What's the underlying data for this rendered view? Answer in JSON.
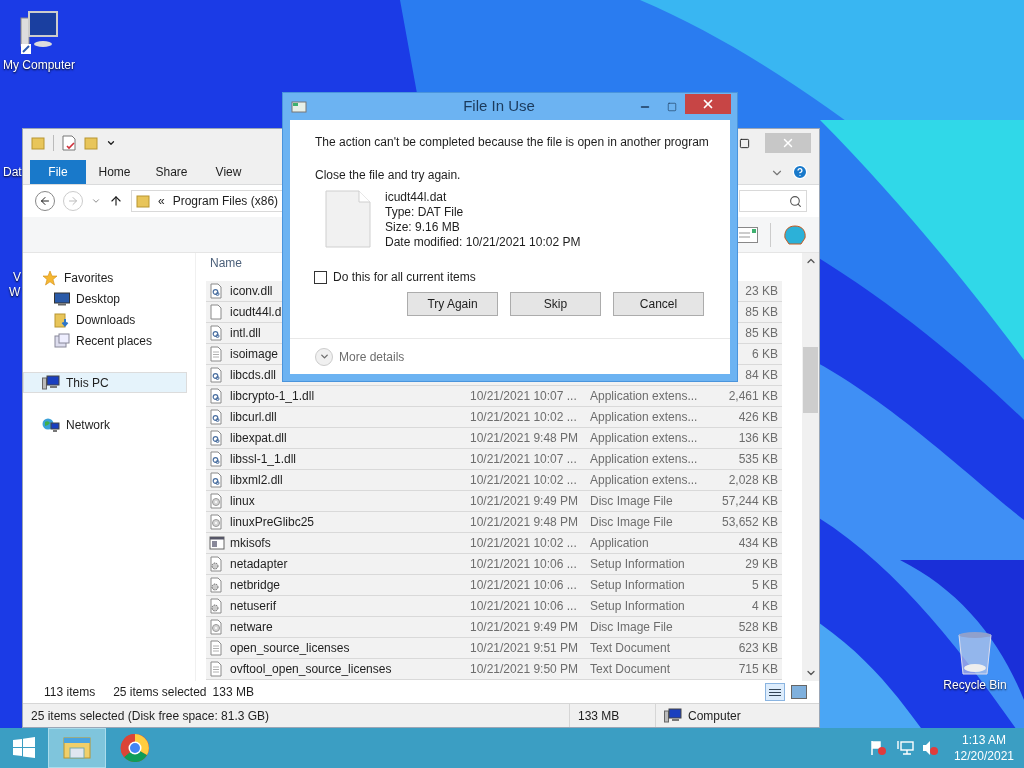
{
  "desktop": {
    "my_computer": "My Computer",
    "partial_labels": [
      "Dat",
      "V",
      "W"
    ],
    "recycle_bin": "Recycle Bin"
  },
  "explorer": {
    "file_menu": "File",
    "tabs": [
      {
        "label": "Home",
        "selected": false
      },
      {
        "label": "Share",
        "selected": false
      },
      {
        "label": "View",
        "selected": false
      }
    ],
    "address": {
      "overflow": "«",
      "path": "Program Files (x86)"
    },
    "nav": [
      {
        "label": "Favorites",
        "kind": "favorites",
        "selected": false,
        "children": [
          {
            "label": "Desktop",
            "kind": "desktop",
            "selected": false
          },
          {
            "label": "Downloads",
            "kind": "downloads",
            "selected": false
          },
          {
            "label": "Recent places",
            "kind": "recent",
            "selected": false
          }
        ]
      },
      {
        "label": "This PC",
        "kind": "pc",
        "selected": true
      },
      {
        "label": "Network",
        "kind": "network",
        "selected": false
      }
    ],
    "columns": [
      "Name"
    ],
    "rows": [
      {
        "name": "iconv.dll",
        "kind": "dll",
        "size": "23 KB",
        "selected": true
      },
      {
        "name": "icudt44l.d",
        "kind": "blank",
        "size": "85 KB",
        "selected": true
      },
      {
        "name": "intl.dll",
        "kind": "dll",
        "size": "85 KB",
        "selected": true
      },
      {
        "name": "isoimage",
        "kind": "text",
        "size": "6 KB",
        "selected": true
      },
      {
        "name": "libcds.dll",
        "kind": "dll",
        "size": "84 KB",
        "selected": true
      },
      {
        "name": "libcrypto-1_1.dll",
        "kind": "dll",
        "date": "10/21/2021 10:07 ...",
        "type": "Application extens...",
        "size": "2,461 KB",
        "selected": true
      },
      {
        "name": "libcurl.dll",
        "kind": "dll",
        "date": "10/21/2021 10:02 ...",
        "type": "Application extens...",
        "size": "426 KB",
        "selected": true
      },
      {
        "name": "libexpat.dll",
        "kind": "dll",
        "date": "10/21/2021 9:48 PM",
        "type": "Application extens...",
        "size": "136 KB",
        "selected": true
      },
      {
        "name": "libssl-1_1.dll",
        "kind": "dll",
        "date": "10/21/2021 10:07 ...",
        "type": "Application extens...",
        "size": "535 KB",
        "selected": true
      },
      {
        "name": "libxml2.dll",
        "kind": "dll",
        "date": "10/21/2021 10:02 ...",
        "type": "Application extens...",
        "size": "2,028 KB",
        "selected": true
      },
      {
        "name": "linux",
        "kind": "disc",
        "date": "10/21/2021 9:49 PM",
        "type": "Disc Image File",
        "size": "57,244 KB",
        "selected": true
      },
      {
        "name": "linuxPreGlibc25",
        "kind": "disc",
        "date": "10/21/2021 9:48 PM",
        "type": "Disc Image File",
        "size": "53,652 KB",
        "selected": true
      },
      {
        "name": "mkisofs",
        "kind": "app",
        "date": "10/21/2021 10:02 ...",
        "type": "Application",
        "size": "434 KB",
        "selected": true
      },
      {
        "name": "netadapter",
        "kind": "setup",
        "date": "10/21/2021 10:06 ...",
        "type": "Setup Information",
        "size": "29 KB",
        "selected": true
      },
      {
        "name": "netbridge",
        "kind": "setup",
        "date": "10/21/2021 10:06 ...",
        "type": "Setup Information",
        "size": "5 KB",
        "selected": true
      },
      {
        "name": "netuserif",
        "kind": "setup",
        "date": "10/21/2021 10:06 ...",
        "type": "Setup Information",
        "size": "4 KB",
        "selected": true
      },
      {
        "name": "netware",
        "kind": "disc",
        "date": "10/21/2021 9:49 PM",
        "type": "Disc Image File",
        "size": "528 KB",
        "selected": true
      },
      {
        "name": "open_source_licenses",
        "kind": "text",
        "date": "10/21/2021 9:51 PM",
        "type": "Text Document",
        "size": "623 KB",
        "selected": true
      },
      {
        "name": "ovftool_open_source_licenses",
        "kind": "text",
        "date": "10/21/2021 9:50 PM",
        "type": "Text Document",
        "size": "715 KB",
        "selected": true
      }
    ],
    "item_count": "113 items",
    "selected_count": "25 items selected",
    "selected_size": "133 MB",
    "status_bar": {
      "text": "25 items selected (Disk free space: 81.3 GB)",
      "size": "133 MB",
      "location": "Computer"
    }
  },
  "dialog": {
    "title": "File In Use",
    "message": "The action can't be completed because the file is open in another program",
    "instruction": "Close the file and try again.",
    "file": {
      "name": "icudt44l.dat",
      "type": "Type: DAT File",
      "size": "Size: 9.16 MB",
      "modified": "Date modified: 10/21/2021 10:02 PM"
    },
    "checkbox": {
      "label": "Do this for all current items",
      "checked": false
    },
    "buttons": [
      "Try Again",
      "Skip",
      "Cancel"
    ],
    "more_details": {
      "label": "More details",
      "expanded": false
    }
  },
  "taskbar": {
    "apps": [
      {
        "kind": "explorer",
        "active": true
      },
      {
        "kind": "chrome",
        "active": false
      }
    ],
    "time": "1:13 AM",
    "date": "12/20/2021"
  }
}
